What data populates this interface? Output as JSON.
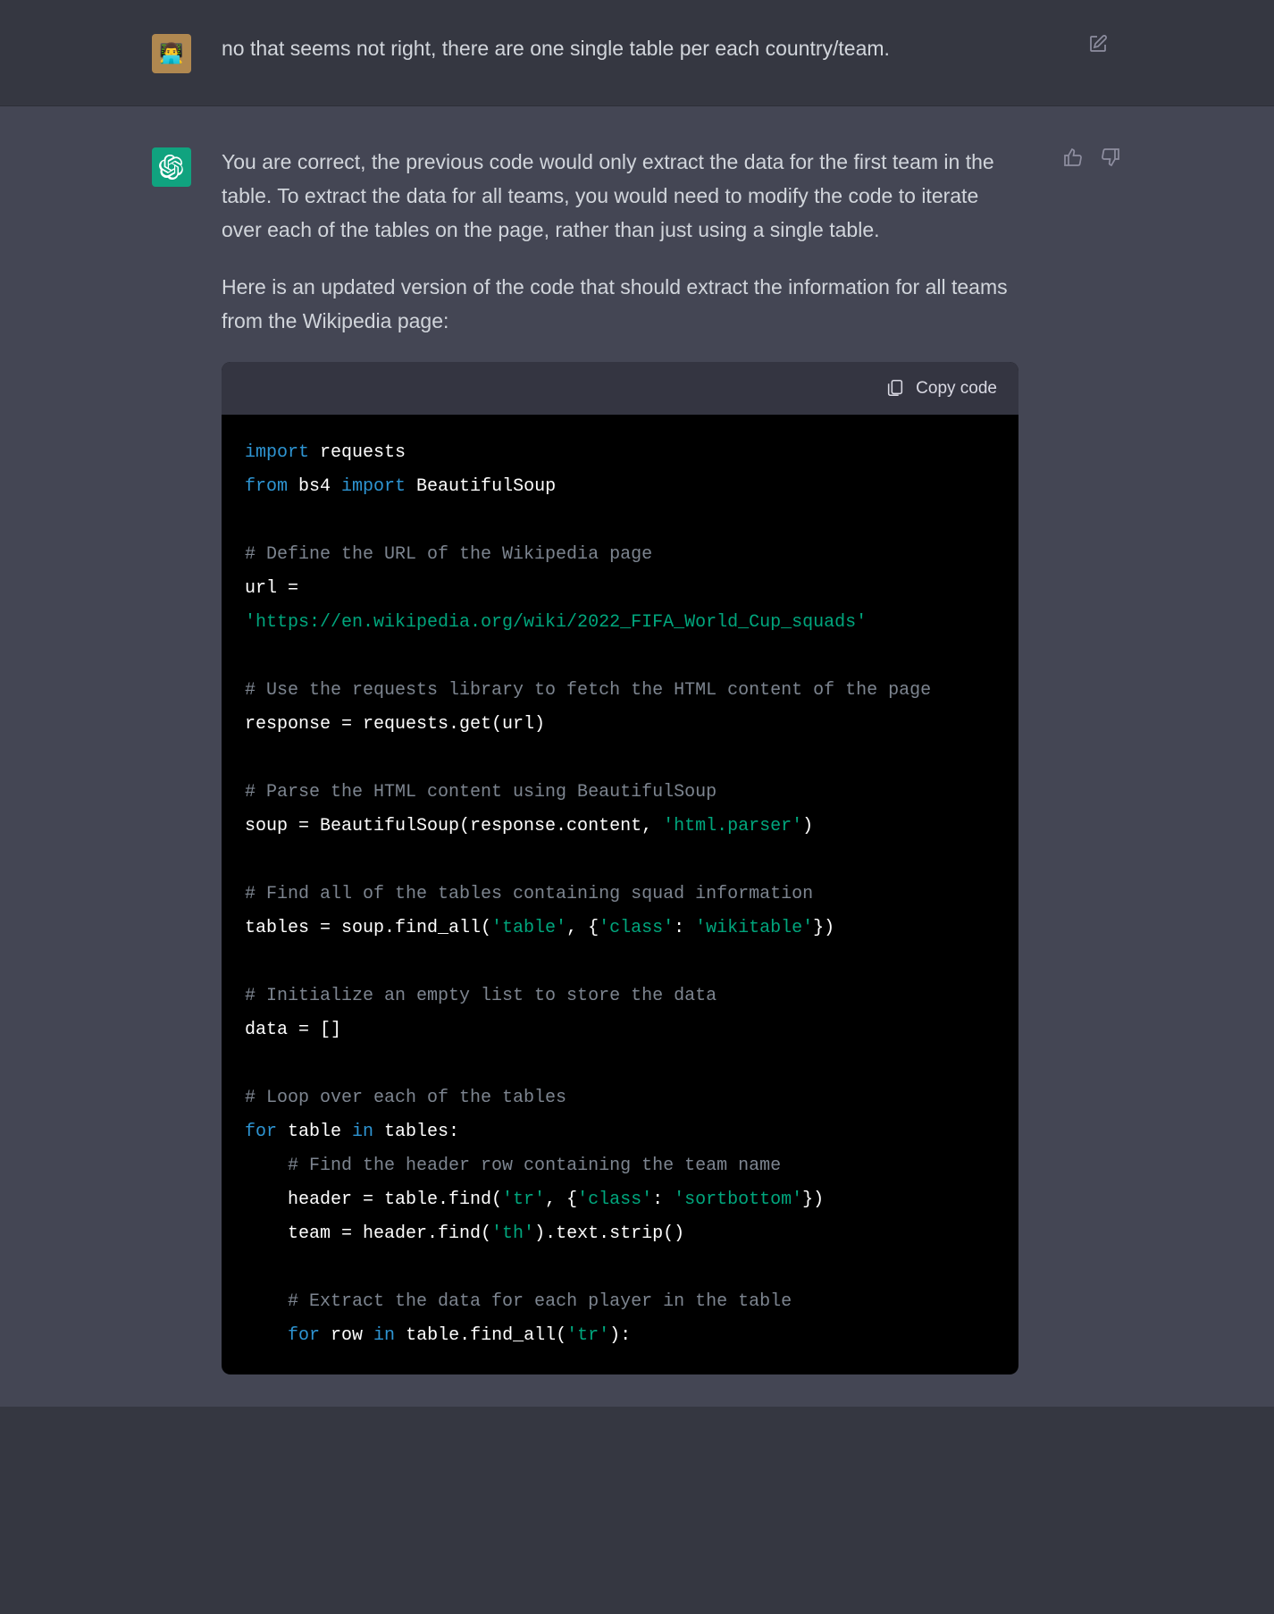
{
  "user_message": {
    "text": "no that seems not right, there are one single table per each country/team.",
    "avatar_emoji": "👨‍💻"
  },
  "assistant_message": {
    "paragraphs": [
      "You are correct, the previous code would only extract the data for the first team in the table. To extract the data for all teams, you would need to modify the code to iterate over each of the tables on the page, rather than just using a single table.",
      "Here is an updated version of the code that should extract the information for all teams from the Wikipedia page:"
    ]
  },
  "code_block": {
    "copy_label": "Copy code",
    "tokens": [
      {
        "t": "kw",
        "v": "import"
      },
      {
        "t": "op",
        "v": " "
      },
      {
        "t": "op",
        "v": "requests"
      },
      {
        "t": "nl"
      },
      {
        "t": "kw",
        "v": "from"
      },
      {
        "t": "op",
        "v": " bs4 "
      },
      {
        "t": "kw",
        "v": "import"
      },
      {
        "t": "op",
        "v": " BeautifulSoup"
      },
      {
        "t": "nl"
      },
      {
        "t": "nl"
      },
      {
        "t": "cm",
        "v": "# Define the URL of the Wikipedia page"
      },
      {
        "t": "nl"
      },
      {
        "t": "op",
        "v": "url = "
      },
      {
        "t": "nl"
      },
      {
        "t": "str",
        "v": "'https://en.wikipedia.org/wiki/2022_FIFA_World_Cup_squads'"
      },
      {
        "t": "nl"
      },
      {
        "t": "nl"
      },
      {
        "t": "cm",
        "v": "# Use the requests library to fetch the HTML content of the page"
      },
      {
        "t": "nl"
      },
      {
        "t": "op",
        "v": "response = requests.get(url)"
      },
      {
        "t": "nl"
      },
      {
        "t": "nl"
      },
      {
        "t": "cm",
        "v": "# Parse the HTML content using BeautifulSoup"
      },
      {
        "t": "nl"
      },
      {
        "t": "op",
        "v": "soup = BeautifulSoup(response.content, "
      },
      {
        "t": "str",
        "v": "'html.parser'"
      },
      {
        "t": "op",
        "v": ")"
      },
      {
        "t": "nl"
      },
      {
        "t": "nl"
      },
      {
        "t": "cm",
        "v": "# Find all of the tables containing squad information"
      },
      {
        "t": "nl"
      },
      {
        "t": "op",
        "v": "tables = soup.find_all("
      },
      {
        "t": "str",
        "v": "'table'"
      },
      {
        "t": "op",
        "v": ", {"
      },
      {
        "t": "str",
        "v": "'class'"
      },
      {
        "t": "op",
        "v": ": "
      },
      {
        "t": "str",
        "v": "'wikitable'"
      },
      {
        "t": "op",
        "v": "})"
      },
      {
        "t": "nl"
      },
      {
        "t": "nl"
      },
      {
        "t": "cm",
        "v": "# Initialize an empty list to store the data"
      },
      {
        "t": "nl"
      },
      {
        "t": "op",
        "v": "data = []"
      },
      {
        "t": "nl"
      },
      {
        "t": "nl"
      },
      {
        "t": "cm",
        "v": "# Loop over each of the tables"
      },
      {
        "t": "nl"
      },
      {
        "t": "kw",
        "v": "for"
      },
      {
        "t": "op",
        "v": " table "
      },
      {
        "t": "kw",
        "v": "in"
      },
      {
        "t": "op",
        "v": " tables:"
      },
      {
        "t": "nl"
      },
      {
        "t": "op",
        "v": "    "
      },
      {
        "t": "cm",
        "v": "# Find the header row containing the team name"
      },
      {
        "t": "nl"
      },
      {
        "t": "op",
        "v": "    header = table.find("
      },
      {
        "t": "str",
        "v": "'tr'"
      },
      {
        "t": "op",
        "v": ", {"
      },
      {
        "t": "str",
        "v": "'class'"
      },
      {
        "t": "op",
        "v": ": "
      },
      {
        "t": "str",
        "v": "'sortbottom'"
      },
      {
        "t": "op",
        "v": "})"
      },
      {
        "t": "nl"
      },
      {
        "t": "op",
        "v": "    team = header.find("
      },
      {
        "t": "str",
        "v": "'th'"
      },
      {
        "t": "op",
        "v": ").text.strip()"
      },
      {
        "t": "nl"
      },
      {
        "t": "nl"
      },
      {
        "t": "op",
        "v": "    "
      },
      {
        "t": "cm",
        "v": "# Extract the data for each player in the table"
      },
      {
        "t": "nl"
      },
      {
        "t": "op",
        "v": "    "
      },
      {
        "t": "kw",
        "v": "for"
      },
      {
        "t": "op",
        "v": " row "
      },
      {
        "t": "kw",
        "v": "in"
      },
      {
        "t": "op",
        "v": " table.find_all("
      },
      {
        "t": "str",
        "v": "'tr'"
      },
      {
        "t": "op",
        "v": "):"
      }
    ]
  }
}
